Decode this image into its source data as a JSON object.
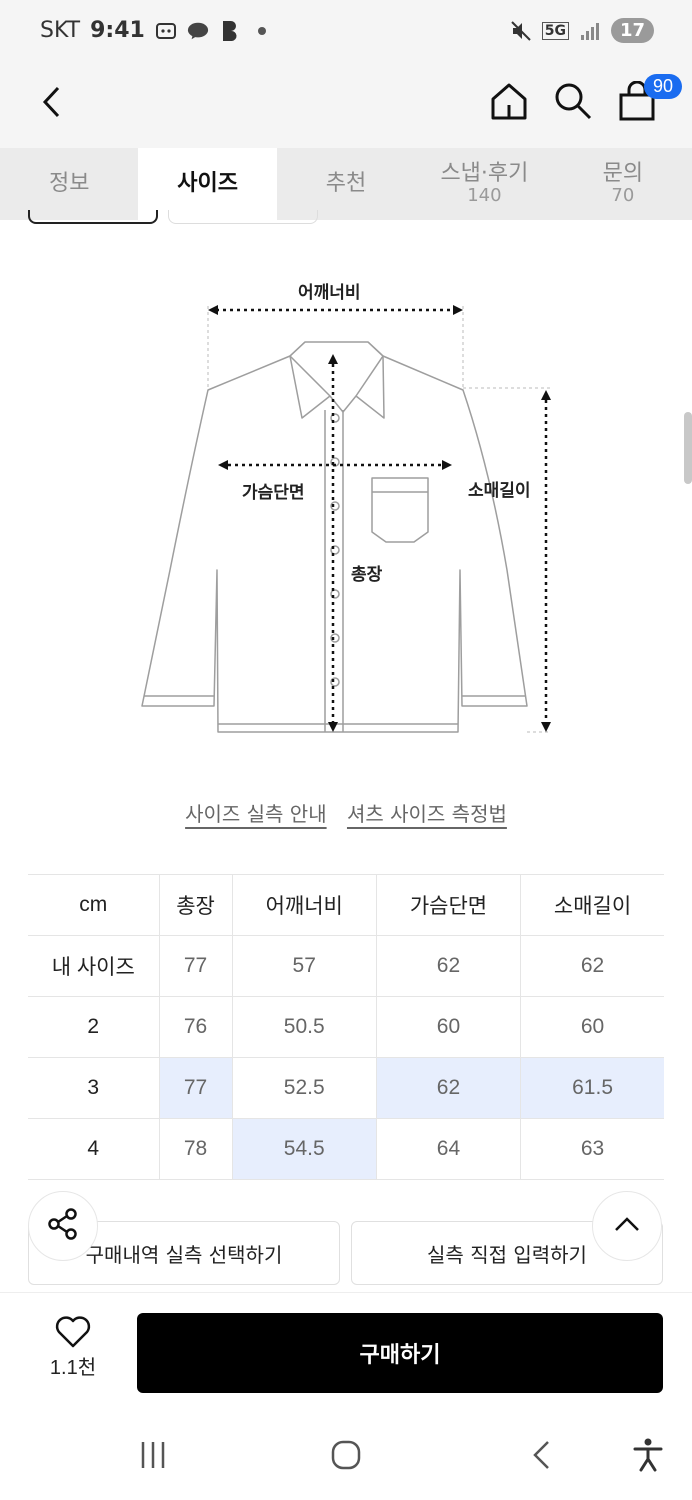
{
  "status": {
    "carrier": "SKT",
    "time": "9:41",
    "network": "5G",
    "battery": "17",
    "icons": [
      "screen-capture-icon",
      "kakaotalk-icon",
      "b-app-icon",
      "dot-icon",
      "mute-icon",
      "signal-icon"
    ]
  },
  "header": {
    "cart_count": "90",
    "icons": [
      "back-arrow-icon",
      "home-icon",
      "search-icon",
      "cart-icon"
    ]
  },
  "tabs": [
    {
      "label": "정보",
      "count": ""
    },
    {
      "label": "사이즈",
      "count": ""
    },
    {
      "label": "추천",
      "count": ""
    },
    {
      "label": "스냅·후기",
      "count": "140"
    },
    {
      "label": "문의",
      "count": "70"
    }
  ],
  "diagram": {
    "shoulder": "어깨너비",
    "chest": "가슴단면",
    "sleeve": "소매길이",
    "length": "총장"
  },
  "guides": {
    "link1": "사이즈 실측 안내",
    "link2": "셔츠 사이즈 측정법"
  },
  "table": {
    "headers": [
      "cm",
      "총장",
      "어깨너비",
      "가슴단면",
      "소매길이"
    ],
    "rows": [
      [
        "내 사이즈",
        "77",
        "57",
        "62",
        "62"
      ],
      [
        "2",
        "76",
        "50.5",
        "60",
        "60"
      ],
      [
        "3",
        "77",
        "52.5",
        "62",
        "61.5"
      ],
      [
        "4",
        "78",
        "54.5",
        "64",
        "63"
      ]
    ],
    "highlight_color": "#e7eefd"
  },
  "actions": {
    "history": "구매내역 실측 선택하기",
    "direct": "실측 직접 입력하기"
  },
  "buybar": {
    "likes": "1.1천",
    "buy": "구매하기"
  },
  "colors": {
    "accent": "#1a6cf0",
    "buy_button": "#000000"
  }
}
